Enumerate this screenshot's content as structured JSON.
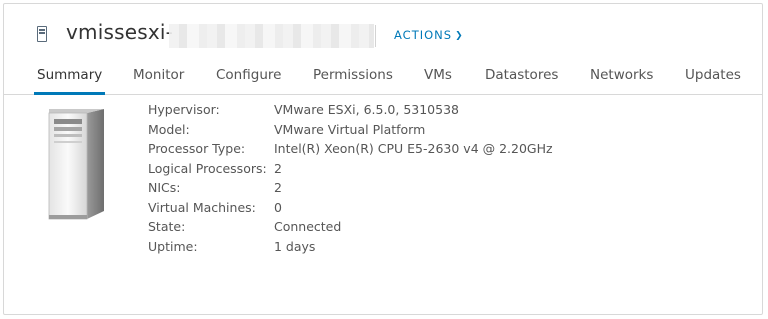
{
  "header": {
    "host_name": "vmissesxi-",
    "actions_label": "ACTIONS",
    "accent_color": "#0079b8"
  },
  "tabs": [
    {
      "label": "Summary",
      "active": true
    },
    {
      "label": "Monitor"
    },
    {
      "label": "Configure"
    },
    {
      "label": "Permissions"
    },
    {
      "label": "VMs"
    },
    {
      "label": "Datastores"
    },
    {
      "label": "Networks"
    },
    {
      "label": "Updates"
    }
  ],
  "summary": {
    "image": "server-tower-icon",
    "properties": [
      {
        "label": "Hypervisor:",
        "value": "VMware ESXi, 6.5.0, 5310538"
      },
      {
        "label": "Model:",
        "value": "VMware Virtual Platform"
      },
      {
        "label": "Processor Type:",
        "value": "Intel(R) Xeon(R) CPU E5-2630 v4 @ 2.20GHz"
      },
      {
        "label": "Logical Processors:",
        "value": "2"
      },
      {
        "label": "NICs:",
        "value": "2"
      },
      {
        "label": "Virtual Machines:",
        "value": "0"
      },
      {
        "label": "State:",
        "value": "Connected"
      },
      {
        "label": "Uptime:",
        "value": "1 days"
      }
    ]
  }
}
